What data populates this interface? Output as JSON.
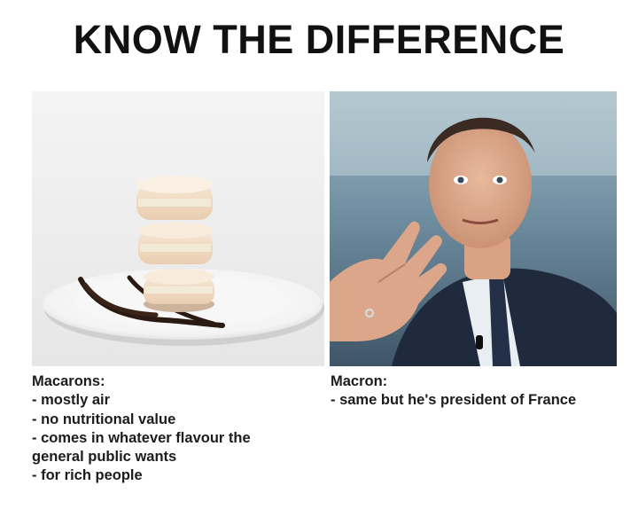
{
  "title": "KNOW THE DIFFERENCE",
  "left": {
    "heading": "Macarons:",
    "lines": [
      "- mostly air",
      "- no nutritional value",
      "- comes in whatever flavour the",
      "general public wants",
      "- for rich people"
    ]
  },
  "right": {
    "heading": "Macron:",
    "lines": [
      "- same but he's president of France"
    ]
  }
}
